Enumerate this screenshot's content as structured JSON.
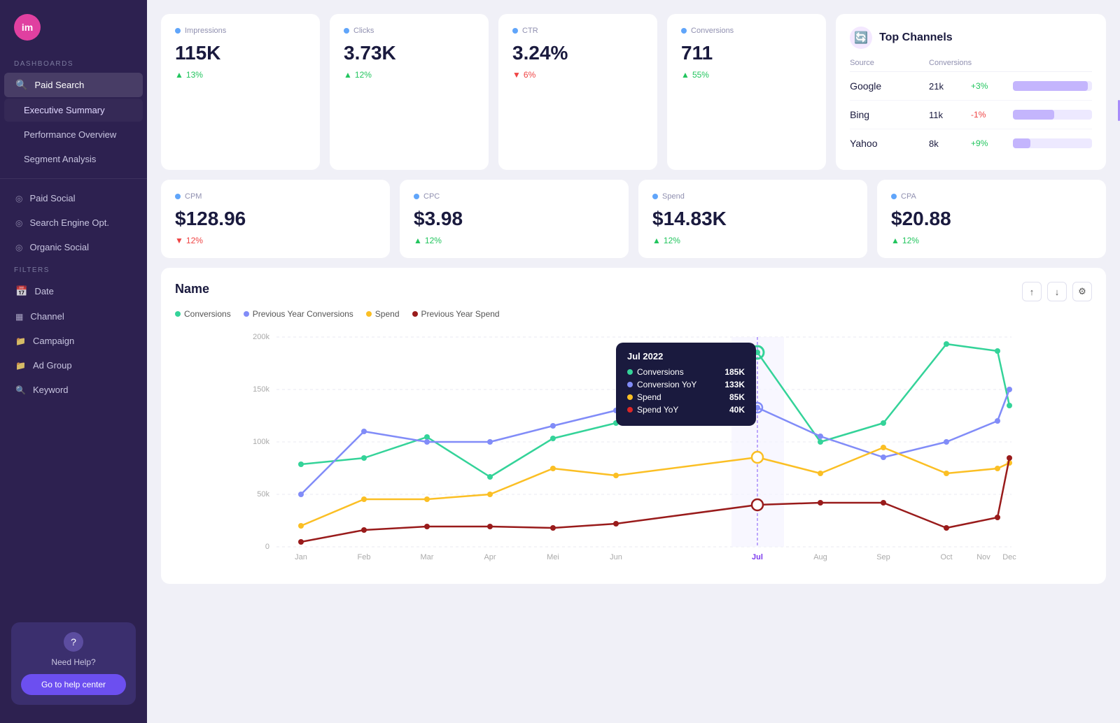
{
  "app": {
    "logo": "im"
  },
  "sidebar": {
    "dashboards_label": "DASHBOARDS",
    "filters_label": "FILTERS",
    "nav_items": [
      {
        "id": "paid-search",
        "label": "Paid Search",
        "icon": "🔍",
        "active": true
      },
      {
        "id": "executive-summary",
        "label": "Executive Summary",
        "icon": "",
        "active_text": true
      },
      {
        "id": "performance-overview",
        "label": "Performance Overview",
        "icon": ""
      },
      {
        "id": "segment-analysis",
        "label": "Segment Analysis",
        "icon": ""
      }
    ],
    "channel_items": [
      {
        "id": "paid-social",
        "label": "Paid Social",
        "icon": "◎"
      },
      {
        "id": "search-engine-opt",
        "label": "Search Engine Opt.",
        "icon": "◎"
      },
      {
        "id": "organic-social",
        "label": "Organic Social",
        "icon": "◎"
      }
    ],
    "filter_items": [
      {
        "id": "date",
        "label": "Date",
        "icon": "📅"
      },
      {
        "id": "channel",
        "label": "Channel",
        "icon": "📊"
      },
      {
        "id": "campaign",
        "label": "Campaign",
        "icon": "📁"
      },
      {
        "id": "ad-group",
        "label": "Ad Group",
        "icon": "📁"
      },
      {
        "id": "keyword",
        "label": "Keyword",
        "icon": "🔍"
      }
    ],
    "help": {
      "need_help": "Need Help?",
      "go_to_help": "Go to help center"
    }
  },
  "metrics_row1": [
    {
      "id": "impressions",
      "label": "Impressions",
      "dot_color": "#60a5fa",
      "value": "115K",
      "change": "13%",
      "direction": "up"
    },
    {
      "id": "clicks",
      "label": "Clicks",
      "dot_color": "#60a5fa",
      "value": "3.73K",
      "change": "12%",
      "direction": "up"
    },
    {
      "id": "ctr",
      "label": "CTR",
      "dot_color": "#60a5fa",
      "value": "3.24%",
      "change": "6%",
      "direction": "down"
    },
    {
      "id": "conversions",
      "label": "Conversions",
      "dot_color": "#60a5fa",
      "value": "711",
      "change": "55%",
      "direction": "up"
    }
  ],
  "metrics_row2": [
    {
      "id": "cpm",
      "label": "CPM",
      "dot_color": "#60a5fa",
      "value": "$128.96",
      "change": "12%",
      "direction": "down"
    },
    {
      "id": "cpc",
      "label": "CPC",
      "dot_color": "#60a5fa",
      "value": "$3.98",
      "change": "12%",
      "direction": "up"
    },
    {
      "id": "spend",
      "label": "Spend",
      "dot_color": "#60a5fa",
      "value": "$14.83K",
      "change": "12%",
      "direction": "up"
    },
    {
      "id": "cpa",
      "label": "CPA",
      "dot_color": "#60a5fa",
      "value": "$20.88",
      "change": "12%",
      "direction": "up"
    }
  ],
  "top_channels": {
    "title": "Top Channels",
    "source_label": "Source",
    "conversions_label": "Conversions",
    "rows": [
      {
        "name": "Google",
        "conv": "21k",
        "change": "+3%",
        "positive": true,
        "bar_pct": 95
      },
      {
        "name": "Bing",
        "conv": "11k",
        "change": "-1%",
        "positive": false,
        "bar_pct": 52
      },
      {
        "name": "Yahoo",
        "conv": "8k",
        "change": "+9%",
        "positive": true,
        "bar_pct": 22
      }
    ]
  },
  "chart": {
    "title": "Name",
    "legend": [
      {
        "label": "Conversions",
        "color": "#34d399"
      },
      {
        "label": "Previous Year Conversions",
        "color": "#818cf8"
      },
      {
        "label": "Spend",
        "color": "#fbbf24"
      },
      {
        "label": "Previous Year Spend",
        "color": "#991b1b"
      }
    ],
    "x_labels": [
      "Jan",
      "Feb",
      "Mar",
      "Apr",
      "Mei",
      "Jun",
      "Jul",
      "Aug",
      "Sep",
      "Oct",
      "Nov",
      "Dec"
    ],
    "y_labels": [
      "0",
      "50k",
      "100k",
      "150k",
      "200k"
    ],
    "tooltip": {
      "month": "Jul 2022",
      "rows": [
        {
          "label": "Conversions",
          "value": "185K",
          "color": "#34d399"
        },
        {
          "label": "Conversion YoY",
          "value": "133K",
          "color": "#818cf8"
        },
        {
          "label": "Spend",
          "value": "85K",
          "color": "#fbbf24"
        },
        {
          "label": "Spend YoY",
          "value": "40K",
          "color": "#dc2626"
        }
      ]
    }
  }
}
